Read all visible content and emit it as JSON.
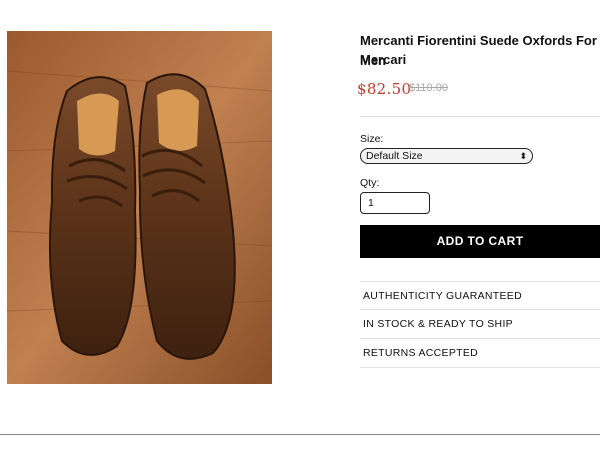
{
  "product": {
    "title": "Mercanti Fiorentini Suede Oxfords For Men",
    "brand": "Mercari",
    "price": "$82.50",
    "original_price": "$110.00",
    "image_icon": "shoe-photo"
  },
  "form": {
    "size_label": "Size:",
    "size_value": "Default Size",
    "qty_label": "Qty:",
    "qty_value": "1",
    "add_to_cart": "ADD TO CART"
  },
  "features": [
    "AUTHENTICITY GUARANTEED",
    "IN STOCK & READY TO SHIP",
    "RETURNS ACCEPTED"
  ],
  "colors": {
    "price": "#c0392b",
    "button_bg": "#000000",
    "button_text": "#ffffff"
  }
}
